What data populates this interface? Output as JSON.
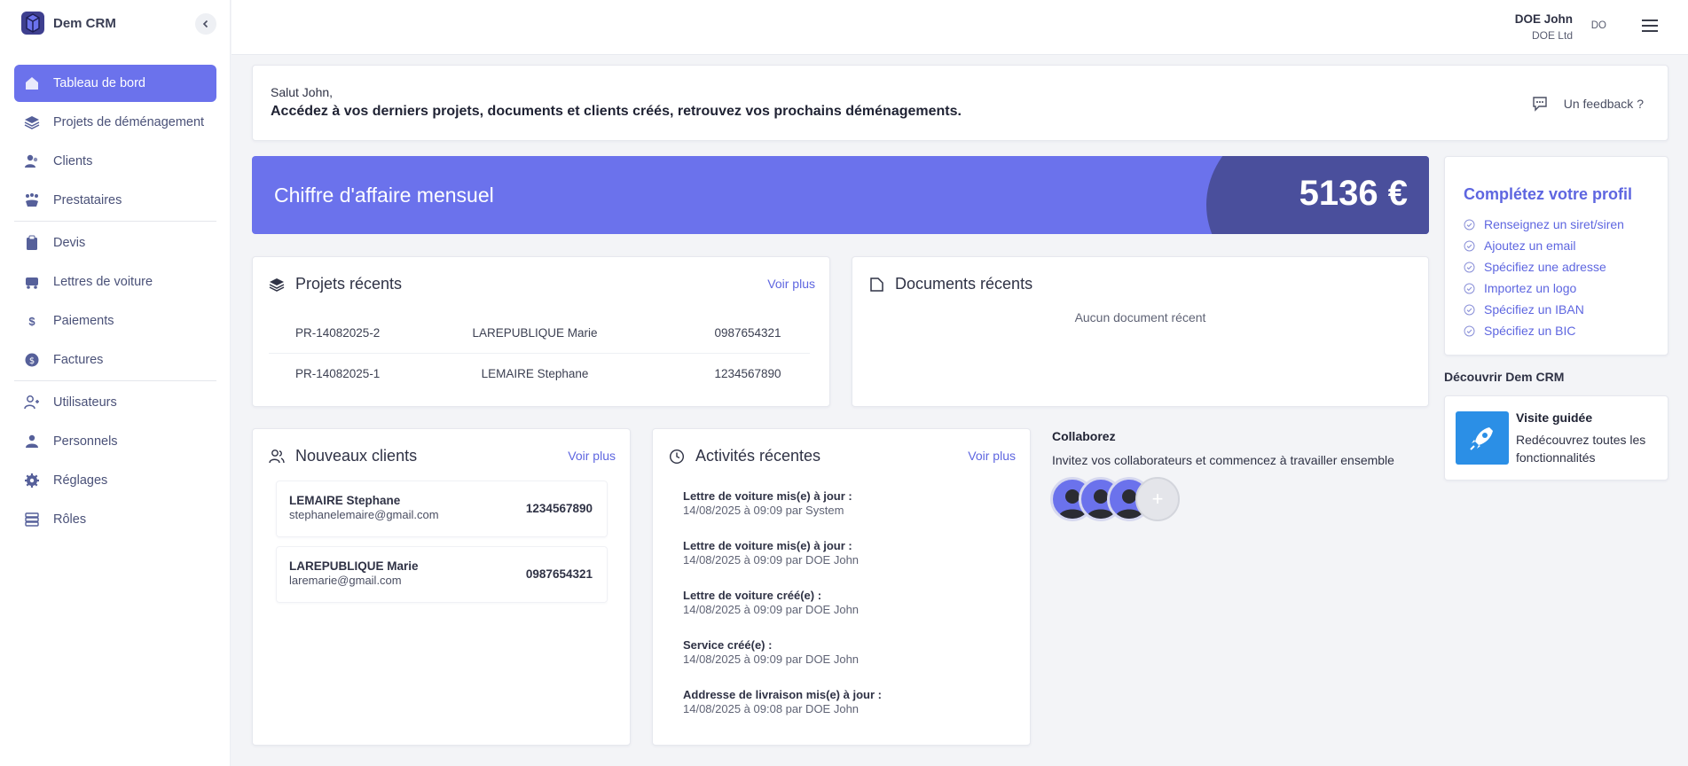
{
  "app": {
    "name": "Dem CRM"
  },
  "sidebar": {
    "items": [
      {
        "label": "Tableau de bord",
        "icon": "home-icon",
        "active": true
      },
      {
        "label": "Projets de déménagement",
        "icon": "layers-icon"
      },
      {
        "label": "Clients",
        "icon": "users-icon"
      },
      {
        "label": "Prestataires",
        "icon": "providers-icon"
      },
      {
        "label": "Devis",
        "icon": "clipboard-icon"
      },
      {
        "label": "Lettres de voiture",
        "icon": "truck-icon"
      },
      {
        "label": "Paiements",
        "icon": "dollar-icon"
      },
      {
        "label": "Factures",
        "icon": "invoice-icon"
      },
      {
        "label": "Utilisateurs",
        "icon": "user-add-icon"
      },
      {
        "label": "Personnels",
        "icon": "staff-icon"
      },
      {
        "label": "Réglages",
        "icon": "gear-icon"
      },
      {
        "label": "Rôles",
        "icon": "roles-icon"
      }
    ]
  },
  "topbar": {
    "user_name": "DOE John",
    "company": "DOE Ltd",
    "initials": "DO"
  },
  "greeting": {
    "hello": "Salut John,",
    "text": "Accédez à vos derniers projets, documents et clients créés, retrouvez vos prochains déménagements.",
    "feedback": "Un feedback ?"
  },
  "revenue": {
    "title": "Chiffre d'affaire mensuel",
    "value": "5136 €"
  },
  "projects": {
    "title": "Projets récents",
    "see_more": "Voir plus",
    "rows": [
      {
        "ref": "PR-14082025-2",
        "client": "LAREPUBLIQUE Marie",
        "phone": "0987654321"
      },
      {
        "ref": "PR-14082025-1",
        "client": "LEMAIRE Stephane",
        "phone": "1234567890"
      }
    ]
  },
  "documents": {
    "title": "Documents récents",
    "empty": "Aucun document récent"
  },
  "profile": {
    "title": "Complétez votre profil",
    "items": [
      "Renseignez un siret/siren",
      "Ajoutez un email",
      "Spécifiez une adresse",
      "Importez un logo",
      "Spécifiez un IBAN",
      "Spécifiez un BIC"
    ]
  },
  "discover": {
    "title": "Découvrir Dem CRM",
    "tour_title": "Visite guidée",
    "tour_text": "Redécouvrez toutes les fonctionnalités"
  },
  "clients": {
    "title": "Nouveaux clients",
    "see_more": "Voir plus",
    "items": [
      {
        "name": "LEMAIRE Stephane",
        "email": "stephanelemaire@gmail.com",
        "phone": "1234567890"
      },
      {
        "name": "LAREPUBLIQUE Marie",
        "email": "laremarie@gmail.com",
        "phone": "0987654321"
      }
    ]
  },
  "activities": {
    "title": "Activités récentes",
    "see_more": "Voir plus",
    "items": [
      {
        "title": "Lettre de voiture mis(e) à jour :",
        "meta": "14/08/2025 à 09:09 par System"
      },
      {
        "title": "Lettre de voiture mis(e) à jour :",
        "meta": "14/08/2025 à 09:09 par DOE John"
      },
      {
        "title": "Lettre de voiture créé(e) :",
        "meta": "14/08/2025 à 09:09 par DOE John"
      },
      {
        "title": "Service créé(e) :",
        "meta": "14/08/2025 à 09:09 par DOE John"
      },
      {
        "title": "Addresse de livraison mis(e) à jour :",
        "meta": "14/08/2025 à 09:08 par DOE John"
      }
    ]
  },
  "collab": {
    "title": "Collaborez",
    "text": "Invitez vos collaborateurs et commencez à travailler ensemble",
    "add": "+"
  },
  "colors": {
    "accent": "#6b72ec",
    "accent_dark": "#4a4f9c",
    "link": "#5e66e0",
    "tour_blue": "#2b8fe6"
  }
}
